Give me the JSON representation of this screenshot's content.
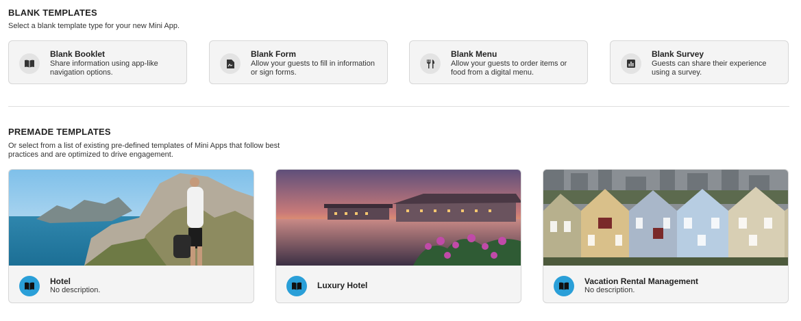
{
  "blank": {
    "title": "BLANK TEMPLATES",
    "description": "Select a blank template type for your new Mini App.",
    "cards": [
      {
        "title": "Blank Booklet",
        "description": "Share information using app-like navigation options.",
        "icon": "book-icon"
      },
      {
        "title": "Blank Form",
        "description": "Allow your guests to fill in information or sign forms.",
        "icon": "form-icon"
      },
      {
        "title": "Blank Menu",
        "description": "Allow your guests to order items or food from a digital menu.",
        "icon": "utensils-icon"
      },
      {
        "title": "Blank Survey",
        "description": "Guests can share their experience using a survey.",
        "icon": "chart-icon"
      }
    ]
  },
  "premade": {
    "title": "PREMADE TEMPLATES",
    "description": "Or select from a list of existing pre-defined templates of Mini Apps that follow best practices and are optimized to drive engagement.",
    "cards": [
      {
        "title": "Hotel",
        "description": "No description.",
        "image": "hiker-coast-photo",
        "icon": "book-icon"
      },
      {
        "title": "Luxury Hotel",
        "description": "",
        "image": "waterfront-resort-sunset-photo",
        "icon": "book-icon"
      },
      {
        "title": "Vacation Rental Management",
        "description": "No description.",
        "image": "victorian-houses-photo",
        "icon": "book-icon"
      }
    ]
  },
  "colors": {
    "accent": "#2a9fd8",
    "card_bg": "#f4f4f4",
    "card_border": "#d6d6d6"
  }
}
